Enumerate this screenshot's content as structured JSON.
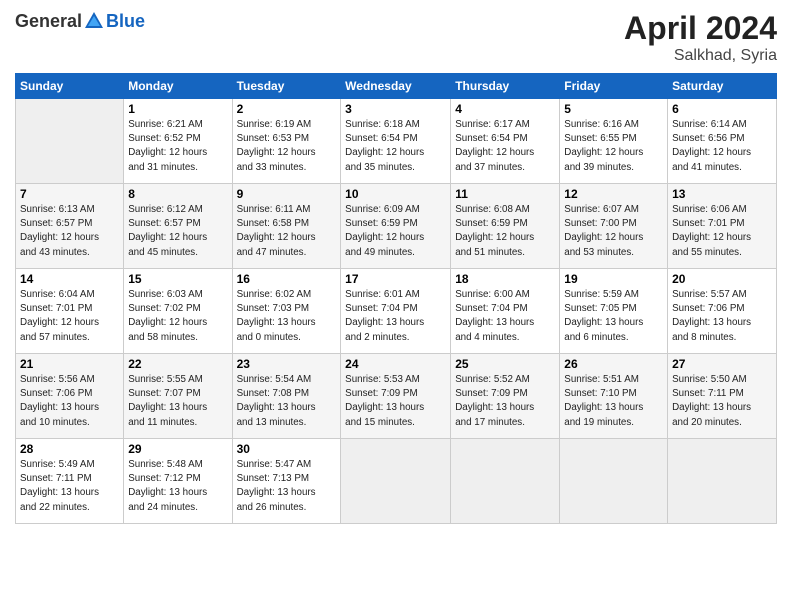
{
  "header": {
    "logo": {
      "general": "General",
      "blue": "Blue"
    },
    "title": "April 2024",
    "location": "Salkhad, Syria"
  },
  "columns": [
    "Sunday",
    "Monday",
    "Tuesday",
    "Wednesday",
    "Thursday",
    "Friday",
    "Saturday"
  ],
  "weeks": [
    [
      {
        "day": "",
        "info": ""
      },
      {
        "day": "1",
        "info": "Sunrise: 6:21 AM\nSunset: 6:52 PM\nDaylight: 12 hours\nand 31 minutes."
      },
      {
        "day": "2",
        "info": "Sunrise: 6:19 AM\nSunset: 6:53 PM\nDaylight: 12 hours\nand 33 minutes."
      },
      {
        "day": "3",
        "info": "Sunrise: 6:18 AM\nSunset: 6:54 PM\nDaylight: 12 hours\nand 35 minutes."
      },
      {
        "day": "4",
        "info": "Sunrise: 6:17 AM\nSunset: 6:54 PM\nDaylight: 12 hours\nand 37 minutes."
      },
      {
        "day": "5",
        "info": "Sunrise: 6:16 AM\nSunset: 6:55 PM\nDaylight: 12 hours\nand 39 minutes."
      },
      {
        "day": "6",
        "info": "Sunrise: 6:14 AM\nSunset: 6:56 PM\nDaylight: 12 hours\nand 41 minutes."
      }
    ],
    [
      {
        "day": "7",
        "info": "Sunrise: 6:13 AM\nSunset: 6:57 PM\nDaylight: 12 hours\nand 43 minutes."
      },
      {
        "day": "8",
        "info": "Sunrise: 6:12 AM\nSunset: 6:57 PM\nDaylight: 12 hours\nand 45 minutes."
      },
      {
        "day": "9",
        "info": "Sunrise: 6:11 AM\nSunset: 6:58 PM\nDaylight: 12 hours\nand 47 minutes."
      },
      {
        "day": "10",
        "info": "Sunrise: 6:09 AM\nSunset: 6:59 PM\nDaylight: 12 hours\nand 49 minutes."
      },
      {
        "day": "11",
        "info": "Sunrise: 6:08 AM\nSunset: 6:59 PM\nDaylight: 12 hours\nand 51 minutes."
      },
      {
        "day": "12",
        "info": "Sunrise: 6:07 AM\nSunset: 7:00 PM\nDaylight: 12 hours\nand 53 minutes."
      },
      {
        "day": "13",
        "info": "Sunrise: 6:06 AM\nSunset: 7:01 PM\nDaylight: 12 hours\nand 55 minutes."
      }
    ],
    [
      {
        "day": "14",
        "info": "Sunrise: 6:04 AM\nSunset: 7:01 PM\nDaylight: 12 hours\nand 57 minutes."
      },
      {
        "day": "15",
        "info": "Sunrise: 6:03 AM\nSunset: 7:02 PM\nDaylight: 12 hours\nand 58 minutes."
      },
      {
        "day": "16",
        "info": "Sunrise: 6:02 AM\nSunset: 7:03 PM\nDaylight: 13 hours\nand 0 minutes."
      },
      {
        "day": "17",
        "info": "Sunrise: 6:01 AM\nSunset: 7:04 PM\nDaylight: 13 hours\nand 2 minutes."
      },
      {
        "day": "18",
        "info": "Sunrise: 6:00 AM\nSunset: 7:04 PM\nDaylight: 13 hours\nand 4 minutes."
      },
      {
        "day": "19",
        "info": "Sunrise: 5:59 AM\nSunset: 7:05 PM\nDaylight: 13 hours\nand 6 minutes."
      },
      {
        "day": "20",
        "info": "Sunrise: 5:57 AM\nSunset: 7:06 PM\nDaylight: 13 hours\nand 8 minutes."
      }
    ],
    [
      {
        "day": "21",
        "info": "Sunrise: 5:56 AM\nSunset: 7:06 PM\nDaylight: 13 hours\nand 10 minutes."
      },
      {
        "day": "22",
        "info": "Sunrise: 5:55 AM\nSunset: 7:07 PM\nDaylight: 13 hours\nand 11 minutes."
      },
      {
        "day": "23",
        "info": "Sunrise: 5:54 AM\nSunset: 7:08 PM\nDaylight: 13 hours\nand 13 minutes."
      },
      {
        "day": "24",
        "info": "Sunrise: 5:53 AM\nSunset: 7:09 PM\nDaylight: 13 hours\nand 15 minutes."
      },
      {
        "day": "25",
        "info": "Sunrise: 5:52 AM\nSunset: 7:09 PM\nDaylight: 13 hours\nand 17 minutes."
      },
      {
        "day": "26",
        "info": "Sunrise: 5:51 AM\nSunset: 7:10 PM\nDaylight: 13 hours\nand 19 minutes."
      },
      {
        "day": "27",
        "info": "Sunrise: 5:50 AM\nSunset: 7:11 PM\nDaylight: 13 hours\nand 20 minutes."
      }
    ],
    [
      {
        "day": "28",
        "info": "Sunrise: 5:49 AM\nSunset: 7:11 PM\nDaylight: 13 hours\nand 22 minutes."
      },
      {
        "day": "29",
        "info": "Sunrise: 5:48 AM\nSunset: 7:12 PM\nDaylight: 13 hours\nand 24 minutes."
      },
      {
        "day": "30",
        "info": "Sunrise: 5:47 AM\nSunset: 7:13 PM\nDaylight: 13 hours\nand 26 minutes."
      },
      {
        "day": "",
        "info": ""
      },
      {
        "day": "",
        "info": ""
      },
      {
        "day": "",
        "info": ""
      },
      {
        "day": "",
        "info": ""
      }
    ]
  ]
}
